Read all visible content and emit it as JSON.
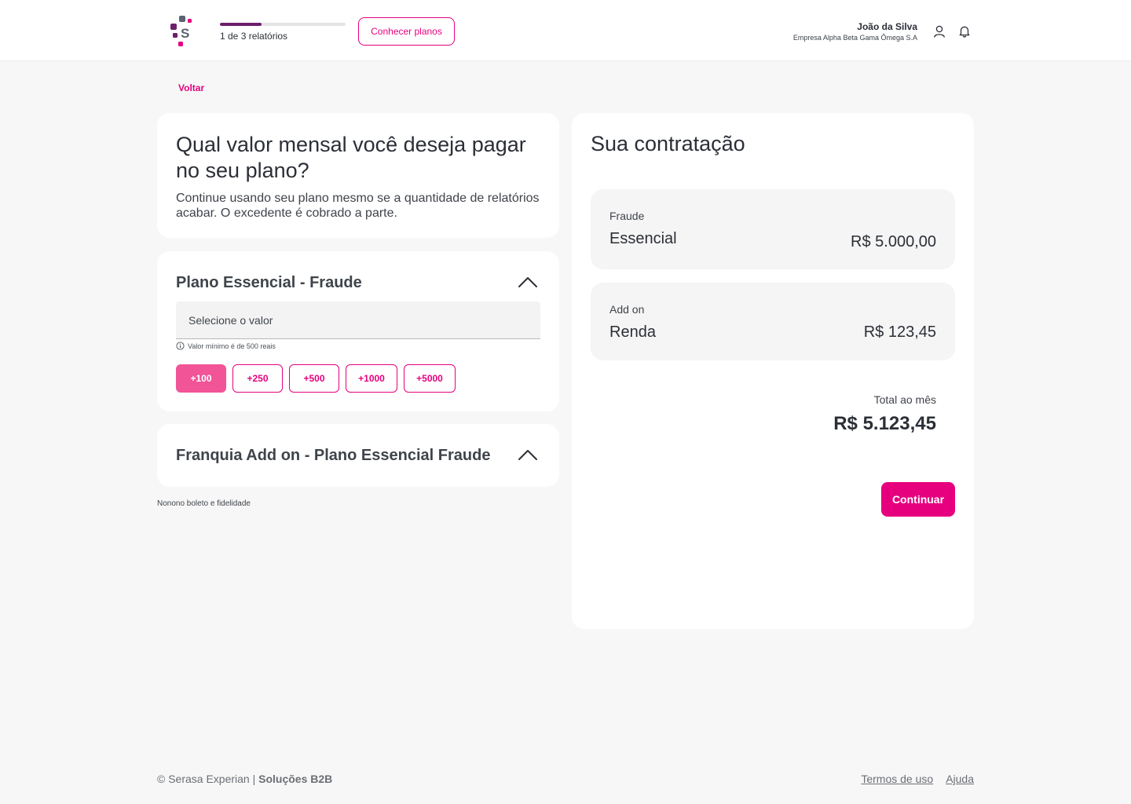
{
  "header": {
    "progress": {
      "label": "1 de 3 relatórios",
      "fraction": 0.333
    },
    "plans_button": "Conhecer planos",
    "user": {
      "name": "João da Silva",
      "company": "Empresa Alpha Beta Gama Ômega S.A"
    },
    "icons": [
      "user-icon",
      "bell-icon"
    ]
  },
  "back_link": "Voltar",
  "intro": {
    "title": "Qual valor mensal você deseja pagar no seu plano?",
    "text": "Continue usando seu plano mesmo se a quantidade de relatórios acabar. O excedente é cobrado a parte."
  },
  "plan": {
    "title": "Plano Essencial - Fraude",
    "select_placeholder": "Selecione o valor",
    "hint": "Valor mínimo é de 500 reais",
    "chips": [
      "+100",
      "+250",
      "+500",
      "+1000",
      "+5000"
    ],
    "active_chip": "+100"
  },
  "addon": {
    "title": "Franquia Add on - Plano Essencial Fraude"
  },
  "footnote": "Nonono boleto e fidelidade",
  "summary": {
    "title": "Sua contratação",
    "items": [
      {
        "label": "Fraude",
        "name": "Essencial",
        "price": "R$ 5.000,00"
      },
      {
        "label": "Add on",
        "name": "Renda",
        "price": "R$ 123,45"
      }
    ],
    "total_label": "Total ao mês",
    "total_value": "R$ 5.123,45",
    "continue": "Continuar"
  },
  "footer": {
    "copyright": "© Serasa Experian | ",
    "brand": "Soluções B2B",
    "links": [
      "Termos de uso",
      "Ajuda"
    ]
  },
  "colors": {
    "accent": "#e6007e",
    "chip_active": "#f15497",
    "logo_purple": "#6b1f6b",
    "background": "#f7f7f7"
  }
}
